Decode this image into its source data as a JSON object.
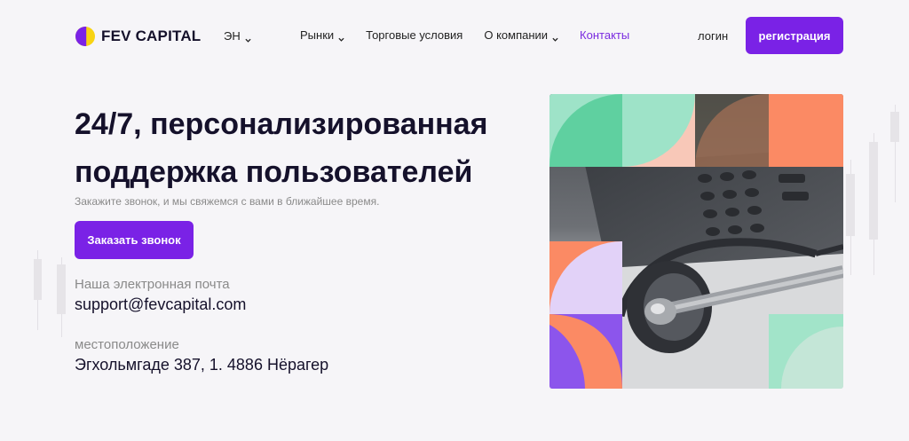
{
  "header": {
    "brand": "FEV CAPITAL",
    "language": "ЭН",
    "nav": [
      {
        "label": "Рынки",
        "dropdown": true,
        "active": false
      },
      {
        "label": "Торговые условия",
        "dropdown": false,
        "active": false
      },
      {
        "label": "О компании",
        "dropdown": true,
        "active": false
      },
      {
        "label": "Контакты",
        "dropdown": false,
        "active": true
      }
    ],
    "login": "логин",
    "register": "регистрация"
  },
  "hero": {
    "title_line1": "24/7, персонализированная",
    "title_line2": "поддержка пользователей",
    "subtitle": "Закажите звонок, и мы свяжемся с вами в ближайшее время.",
    "cta": "Заказать звонок"
  },
  "contact": {
    "email_label": "Наша электронная почта",
    "email": "support@fevcapital.com",
    "location_label": "местоположение",
    "location": "Эгхольмгаде 387, 1. 4886 Нёрагер"
  },
  "colors": {
    "accent": "#7a22e6",
    "active_link": "#7a2be0",
    "logo_yellow": "#f8d312",
    "logo_purple": "#7a22e6",
    "tile_mint": "#9ee3c8",
    "tile_green": "#5fd0a0",
    "tile_peach": "#f8c8b8",
    "tile_orange": "#fb8a64",
    "tile_lavender": "#e2d2f8",
    "tile_purple": "#8c55ec"
  },
  "icons": {
    "logo": "logo-icon",
    "dropdown": "chevron-down-icon"
  }
}
